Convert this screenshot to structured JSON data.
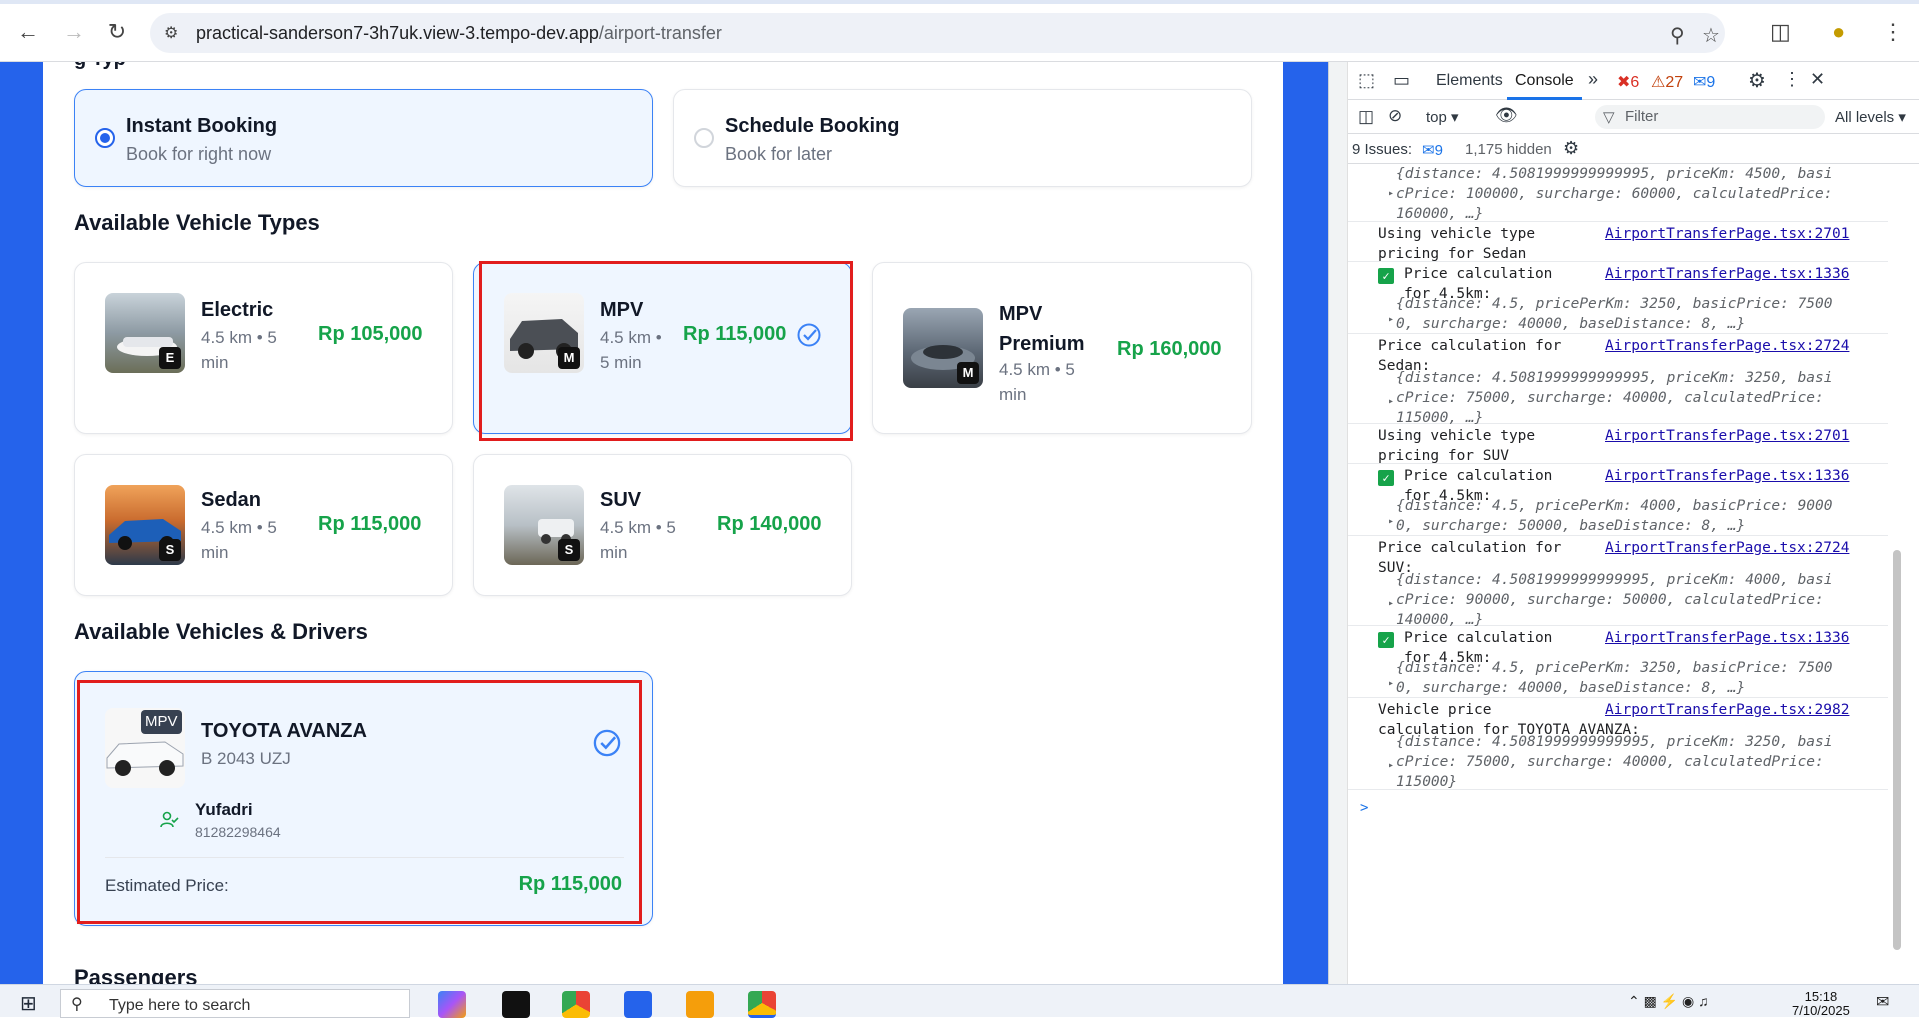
{
  "browser": {
    "url_domain": "practical-sanderson7-3h7uk.view-3.tempo-dev.app",
    "url_path": "/airport-transfer"
  },
  "booking": {
    "partial_heading": "g Typ",
    "options": [
      {
        "title": "Instant Booking",
        "subtitle": "Book for right now",
        "selected": true
      },
      {
        "title": "Schedule Booking",
        "subtitle": "Book for later",
        "selected": false
      }
    ]
  },
  "vehicle_types": {
    "heading": "Available Vehicle Types",
    "items": [
      {
        "name": "Electric",
        "meta": "4.5 km • 5 min",
        "price": "Rp 105,000",
        "badge": "E",
        "selected": false
      },
      {
        "name": "MPV",
        "meta": "4.5 km • 5 min",
        "price": "Rp 115,000",
        "badge": "M",
        "selected": true
      },
      {
        "name": "MPV Premium",
        "meta": "4.5 km • 5 min",
        "price": "Rp 160,000",
        "badge": "M",
        "selected": false
      },
      {
        "name": "Sedan",
        "meta": "4.5 km • 5 min",
        "price": "Rp 115,000",
        "badge": "S",
        "selected": false
      },
      {
        "name": "SUV",
        "meta": "4.5 km • 5 min",
        "price": "Rp 140,000",
        "badge": "S",
        "selected": false
      }
    ]
  },
  "vehicles_drivers": {
    "heading": "Available Vehicles & Drivers",
    "vehicle": {
      "type_badge": "MPV",
      "name": "TOYOTA AVANZA",
      "plate": "B 2043 UZJ",
      "driver_name": "Yufadri",
      "driver_phone": "81282298464",
      "estimated_label": "Estimated Price:",
      "estimated_price": "Rp 115,000"
    }
  },
  "passengers_heading": "Passengers",
  "devtools": {
    "tabs": [
      "Elements",
      "Console"
    ],
    "active_tab": "Console",
    "errors": "6",
    "warnings": "27",
    "messages": "9",
    "context": "top",
    "filter_placeholder": "Filter",
    "levels": "All levels",
    "issues_label": "9 Issues:",
    "issues_count": "9",
    "hidden": "1,175 hidden",
    "prompt": ">",
    "entries": [
      {
        "lines": [],
        "obj": "{distance: 4.5081999999999995, priceKm: 4500, basi\ncPrice: 100000, surcharge: 60000, calculatedPrice:\n160000, …}"
      },
      {
        "lines": "Using vehicle type\npricing for Sedan",
        "link": "AirportTransferPage.tsx:2701"
      },
      {
        "check": true,
        "lines": "Price calculation\nfor 4.5km:",
        "link": "AirportTransferPage.tsx:1336",
        "obj": "{distance: 4.5, pricePerKm: 3250, basicPrice: 7500\n0, surcharge: 40000, baseDistance: 8, …}"
      },
      {
        "lines": "Price calculation for\nSedan:",
        "link": "AirportTransferPage.tsx:2724",
        "obj": "{distance: 4.5081999999999995, priceKm: 3250, basi\ncPrice: 75000, surcharge: 40000, calculatedPrice:\n115000, …}"
      },
      {
        "lines": "Using vehicle type\npricing for SUV",
        "link": "AirportTransferPage.tsx:2701"
      },
      {
        "check": true,
        "lines": "Price calculation\nfor 4.5km:",
        "link": "AirportTransferPage.tsx:1336",
        "obj": "{distance: 4.5, pricePerKm: 4000, basicPrice: 9000\n0, surcharge: 50000, baseDistance: 8, …}"
      },
      {
        "lines": "Price calculation for\nSUV:",
        "link": "AirportTransferPage.tsx:2724",
        "obj": "{distance: 4.5081999999999995, priceKm: 4000, basi\ncPrice: 90000, surcharge: 50000, calculatedPrice:\n140000, …}"
      },
      {
        "check": true,
        "lines": "Price calculation\nfor 4.5km:",
        "link": "AirportTransferPage.tsx:1336",
        "obj": "{distance: 4.5, pricePerKm: 3250, basicPrice: 7500\n0, surcharge: 40000, baseDistance: 8, …}"
      },
      {
        "lines": "Vehicle price\ncalculation for TOYOTA AVANZA:",
        "link": "AirportTransferPage.tsx:2982",
        "obj": "{distance: 4.5081999999999995, priceKm: 3250, basi\ncPrice: 75000, surcharge: 40000, calculatedPrice:\n115000}"
      }
    ]
  },
  "taskbar": {
    "search_placeholder": "Type here to search",
    "time": "15:18",
    "date": "7/10/2025"
  },
  "colors": {
    "accent": "#2563eb",
    "price_green": "#16a34a",
    "highlight_red": "#e11d1d"
  }
}
